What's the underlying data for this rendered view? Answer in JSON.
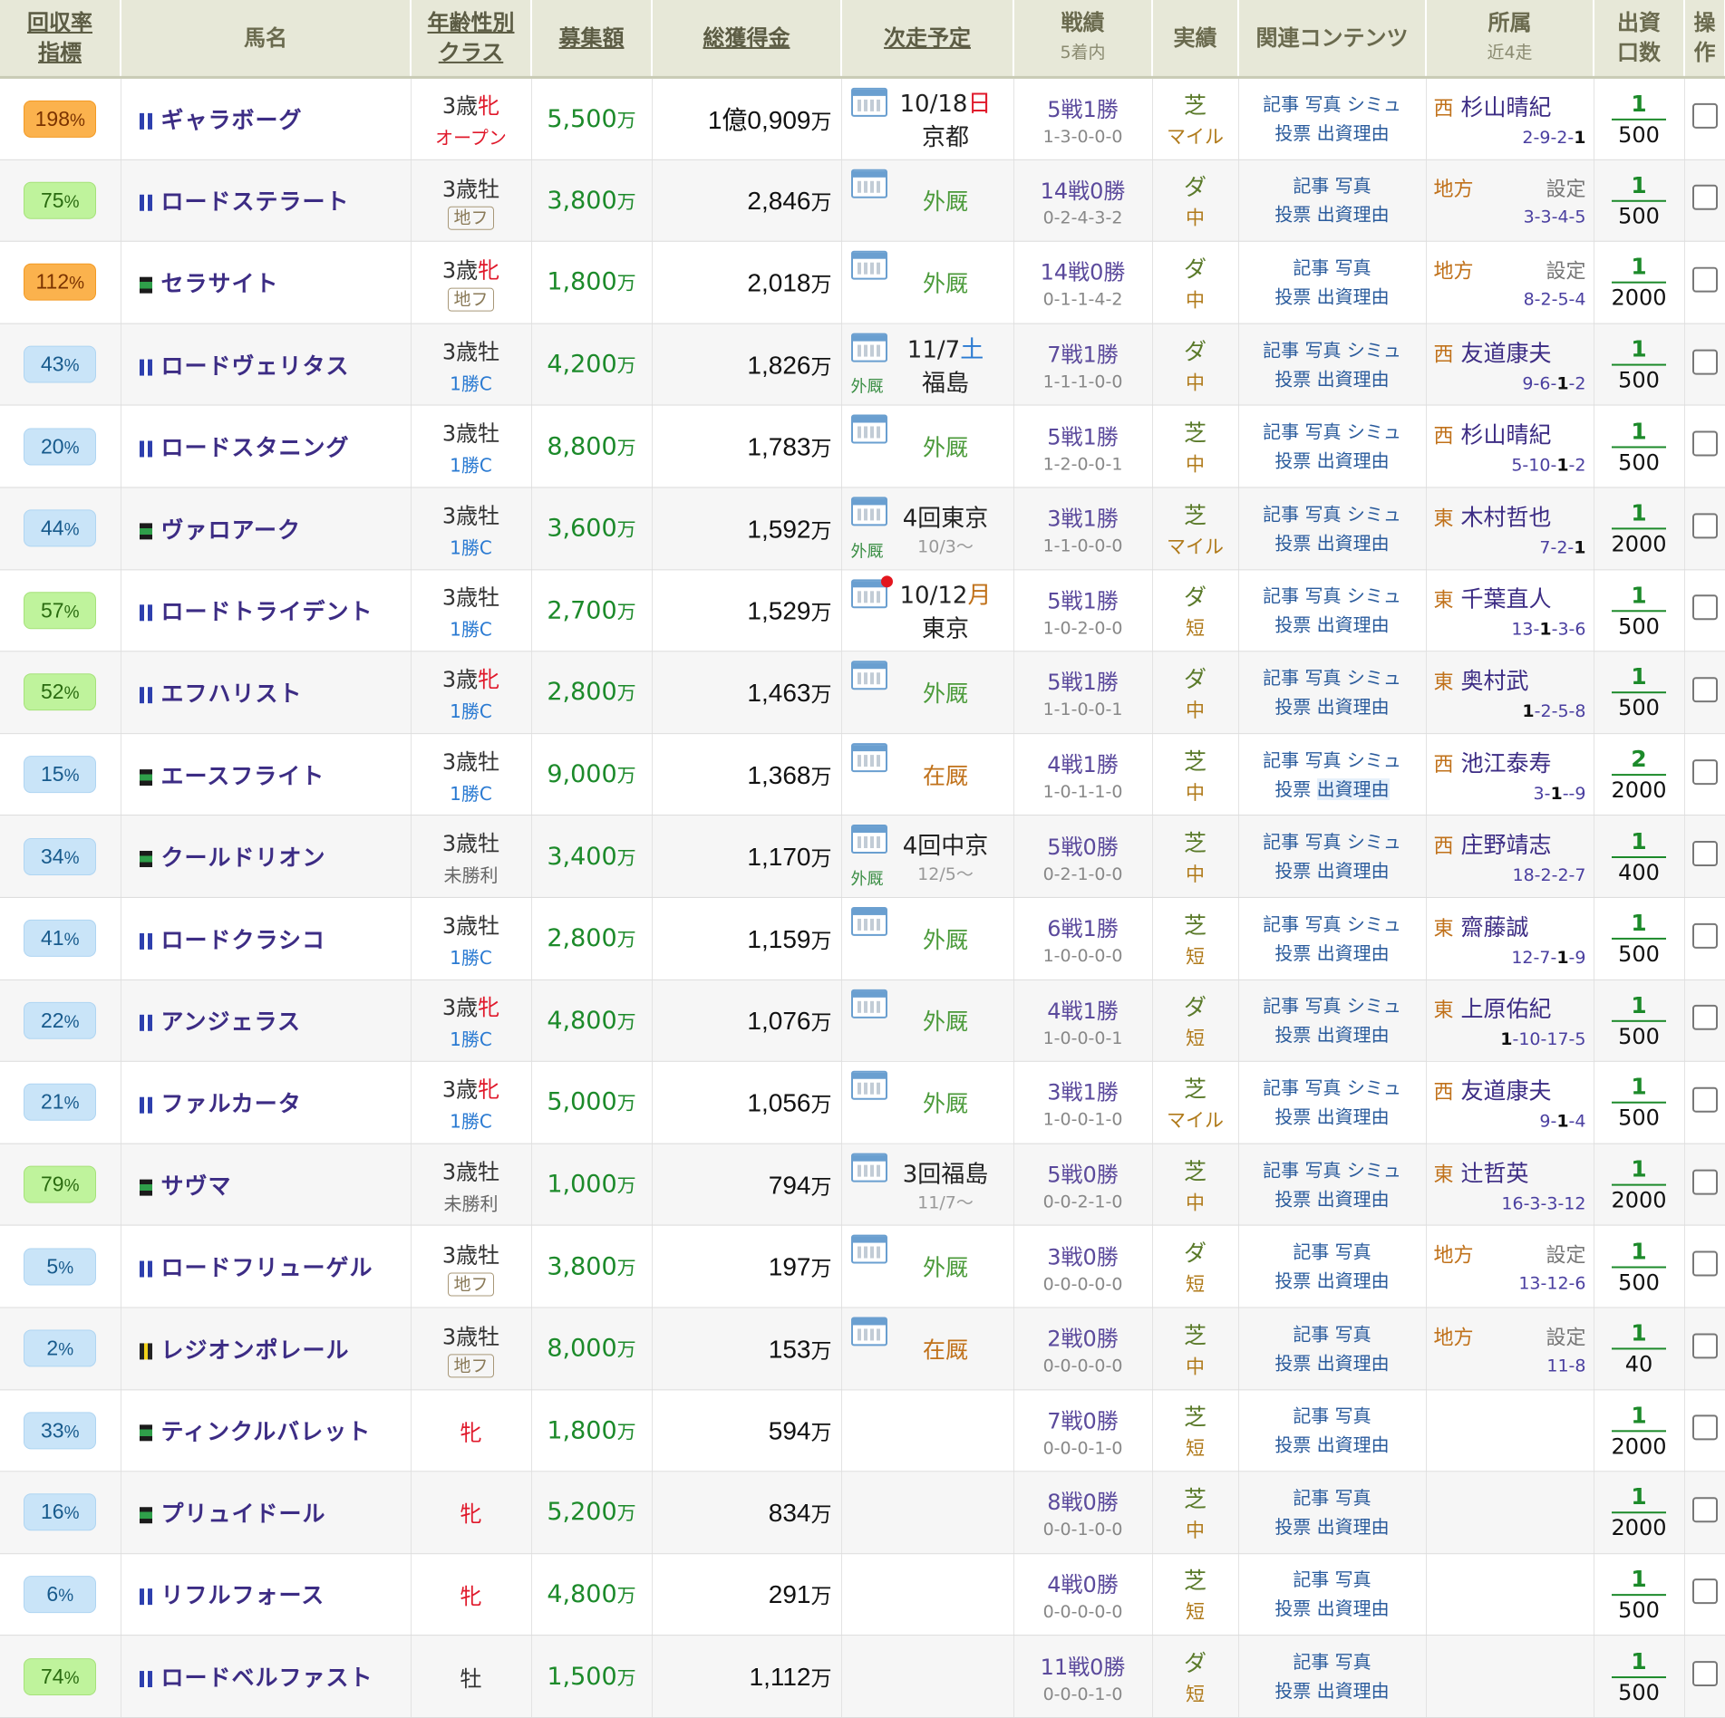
{
  "header": {
    "rate": [
      "回収率",
      "指標"
    ],
    "name": "馬名",
    "age": [
      "年齢性別",
      "クラス"
    ],
    "bosyu": "募集額",
    "prize": "総獲得金",
    "next": "次走予定",
    "record": [
      "戦績",
      "5着内"
    ],
    "perf": "実績",
    "links": "関連コンテンツ",
    "affil": [
      "所属",
      "近4走"
    ],
    "invest": [
      "出資",
      "口数"
    ],
    "op": [
      "操",
      "作"
    ]
  },
  "link_labels": {
    "kiji": "記事",
    "shashin": "写真",
    "shimu": "シミュ",
    "tohyo": "投票",
    "riyu": "出資理由"
  },
  "unit": "万",
  "rows": [
    {
      "rate": "198",
      "rc": "hi",
      "flag": "blue",
      "name": "ギャラボーグ",
      "age": "3歳",
      "sex": "牝",
      "cls": "オープン",
      "ct": "open",
      "bosyu": "5,500",
      "prize": "1億0,909",
      "next": {
        "date": "10/18",
        "dow": "日",
        "dowc": "sun",
        "place": "京都"
      },
      "rec": "5戦1勝",
      "rec2": "1-3-0-0-0",
      "surf": "芝",
      "dist": "マイル",
      "shimu": true,
      "region": "西",
      "trainer": "杉山晴紀",
      "settei": "",
      "recent": [
        "2-9-2-",
        "1"
      ],
      "k1": "1",
      "k2": "500"
    },
    {
      "rate": "75",
      "rc": "mid",
      "flag": "blue",
      "name": "ロードステラート",
      "age": "3歳",
      "sex": "牡",
      "cls": "地フ",
      "ct": "chiho",
      "bosyu": "3,800",
      "prize": "2,846",
      "next": {
        "stat": "外厩"
      },
      "rec": "14戦0勝",
      "rec2": "0-2-4-3-2",
      "surf": "ダ",
      "dist": "中",
      "shimu": false,
      "region": "地方",
      "trainer": "",
      "settei": "設定",
      "recent": [
        "3-3-4-5",
        ""
      ],
      "k1": "1",
      "k2": "500"
    },
    {
      "rate": "112",
      "rc": "hi",
      "flag": "black",
      "name": "セラサイト",
      "age": "3歳",
      "sex": "牝",
      "cls": "地フ",
      "ct": "chiho",
      "bosyu": "1,800",
      "prize": "2,018",
      "next": {
        "stat": "外厩"
      },
      "rec": "14戦0勝",
      "rec2": "0-1-1-4-2",
      "surf": "ダ",
      "dist": "中",
      "shimu": false,
      "region": "地方",
      "trainer": "",
      "settei": "設定",
      "recent": [
        "8-2-5-4",
        ""
      ],
      "k1": "1",
      "k2": "2000"
    },
    {
      "rate": "43",
      "rc": "lo",
      "flag": "blue",
      "name": "ロードヴェリタス",
      "age": "3歳",
      "sex": "牡",
      "cls": "1勝C",
      "ct": "c1",
      "bosyu": "4,200",
      "prize": "1,826",
      "next": {
        "date": "11/7",
        "dow": "土",
        "dowc": "sat",
        "place": "福島",
        "gk": "外厩"
      },
      "rec": "7戦1勝",
      "rec2": "1-1-1-0-0",
      "surf": "ダ",
      "dist": "中",
      "shimu": true,
      "region": "西",
      "trainer": "友道康夫",
      "settei": "",
      "recent": [
        "9-6-",
        "1",
        "-2"
      ],
      "k1": "1",
      "k2": "500"
    },
    {
      "rate": "20",
      "rc": "lo",
      "flag": "blue",
      "name": "ロードスタニング",
      "age": "3歳",
      "sex": "牡",
      "cls": "1勝C",
      "ct": "c1",
      "bosyu": "8,800",
      "prize": "1,783",
      "next": {
        "stat": "外厩"
      },
      "rec": "5戦1勝",
      "rec2": "1-2-0-0-1",
      "surf": "芝",
      "dist": "中",
      "shimu": true,
      "region": "西",
      "trainer": "杉山晴紀",
      "settei": "",
      "recent": [
        "5-10-",
        "1",
        "-2"
      ],
      "k1": "1",
      "k2": "500"
    },
    {
      "rate": "44",
      "rc": "lo",
      "flag": "black",
      "name": "ヴァロアーク",
      "age": "3歳",
      "sex": "牡",
      "cls": "1勝C",
      "ct": "c1",
      "bosyu": "3,600",
      "prize": "1,592",
      "next": {
        "main": "4回東京",
        "sub": "10/3～",
        "gk": "外厩"
      },
      "rec": "3戦1勝",
      "rec2": "1-1-0-0-0",
      "surf": "芝",
      "dist": "マイル",
      "shimu": true,
      "region": "東",
      "trainer": "木村哲也",
      "settei": "",
      "recent": [
        "7-2-",
        "1"
      ],
      "k1": "1",
      "k2": "2000"
    },
    {
      "rate": "57",
      "rc": "mid",
      "flag": "blue",
      "name": "ロードトライデント",
      "age": "3歳",
      "sex": "牡",
      "cls": "1勝C",
      "ct": "c1",
      "bosyu": "2,700",
      "prize": "1,529",
      "next": {
        "date": "10/12",
        "dow": "月",
        "dowc": "mon",
        "place": "東京",
        "dot": true
      },
      "rec": "5戦1勝",
      "rec2": "1-0-2-0-0",
      "surf": "ダ",
      "dist": "短",
      "shimu": true,
      "region": "東",
      "trainer": "千葉直人",
      "settei": "",
      "recent": [
        "13-",
        "1",
        "-3-6"
      ],
      "k1": "1",
      "k2": "500"
    },
    {
      "rate": "52",
      "rc": "mid",
      "flag": "blue",
      "name": "エフハリスト",
      "age": "3歳",
      "sex": "牝",
      "cls": "1勝C",
      "ct": "c1",
      "bosyu": "2,800",
      "prize": "1,463",
      "next": {
        "stat": "外厩"
      },
      "rec": "5戦1勝",
      "rec2": "1-1-0-0-1",
      "surf": "ダ",
      "dist": "中",
      "shimu": true,
      "region": "東",
      "trainer": "奥村武",
      "settei": "",
      "recent": [
        "",
        "1",
        "-2-5-8"
      ],
      "k1": "1",
      "k2": "500"
    },
    {
      "rate": "15",
      "rc": "lo",
      "flag": "black",
      "name": "エースフライト",
      "age": "3歳",
      "sex": "牡",
      "cls": "1勝C",
      "ct": "c1",
      "bosyu": "9,000",
      "prize": "1,368",
      "next": {
        "stat": "在厩",
        "in": true
      },
      "rec": "4戦1勝",
      "rec2": "1-0-1-1-0",
      "surf": "芝",
      "dist": "中",
      "shimu": true,
      "hl": true,
      "region": "西",
      "trainer": "池江泰寿",
      "settei": "",
      "recent": [
        "3-",
        "1",
        "--9"
      ],
      "k1": "2",
      "k2": "2000"
    },
    {
      "rate": "34",
      "rc": "lo",
      "flag": "black",
      "name": "クールドリオン",
      "age": "3歳",
      "sex": "牡",
      "cls": "未勝利",
      "ct": "plain",
      "bosyu": "3,400",
      "prize": "1,170",
      "next": {
        "main": "4回中京",
        "sub": "12/5～",
        "gk": "外厩"
      },
      "rec": "5戦0勝",
      "rec2": "0-2-1-0-0",
      "surf": "芝",
      "dist": "中",
      "shimu": true,
      "region": "西",
      "trainer": "庄野靖志",
      "settei": "",
      "recent": [
        "18-2-2-7",
        ""
      ],
      "k1": "1",
      "k2": "400"
    },
    {
      "rate": "41",
      "rc": "lo",
      "flag": "blue",
      "name": "ロードクラシコ",
      "age": "3歳",
      "sex": "牡",
      "cls": "1勝C",
      "ct": "c1",
      "bosyu": "2,800",
      "prize": "1,159",
      "next": {
        "stat": "外厩"
      },
      "rec": "6戦1勝",
      "rec2": "1-0-0-0-0",
      "surf": "芝",
      "dist": "短",
      "shimu": true,
      "region": "東",
      "trainer": "齋藤誠",
      "settei": "",
      "recent": [
        "12-7-",
        "1",
        "-9"
      ],
      "k1": "1",
      "k2": "500"
    },
    {
      "rate": "22",
      "rc": "lo",
      "flag": "blue",
      "name": "アンジェラス",
      "age": "3歳",
      "sex": "牝",
      "cls": "1勝C",
      "ct": "c1",
      "bosyu": "4,800",
      "prize": "1,076",
      "next": {
        "stat": "外厩"
      },
      "rec": "4戦1勝",
      "rec2": "1-0-0-0-1",
      "surf": "ダ",
      "dist": "短",
      "shimu": true,
      "region": "東",
      "trainer": "上原佑紀",
      "settei": "",
      "recent": [
        "",
        "1",
        "-10-17-5"
      ],
      "k1": "1",
      "k2": "500"
    },
    {
      "rate": "21",
      "rc": "lo",
      "flag": "blue",
      "name": "ファルカータ",
      "age": "3歳",
      "sex": "牝",
      "cls": "1勝C",
      "ct": "c1",
      "bosyu": "5,000",
      "prize": "1,056",
      "next": {
        "stat": "外厩"
      },
      "rec": "3戦1勝",
      "rec2": "1-0-0-1-0",
      "surf": "芝",
      "dist": "マイル",
      "shimu": true,
      "region": "西",
      "trainer": "友道康夫",
      "settei": "",
      "recent": [
        "9-",
        "1",
        "-4"
      ],
      "k1": "1",
      "k2": "500"
    },
    {
      "rate": "79",
      "rc": "mid",
      "flag": "black",
      "name": "サヴマ",
      "age": "3歳",
      "sex": "牡",
      "cls": "未勝利",
      "ct": "plain",
      "bosyu": "1,000",
      "prize": "794",
      "next": {
        "main": "3回福島",
        "sub": "11/7～"
      },
      "rec": "5戦0勝",
      "rec2": "0-0-2-1-0",
      "surf": "芝",
      "dist": "中",
      "shimu": true,
      "region": "東",
      "trainer": "辻哲英",
      "settei": "",
      "recent": [
        "16-3-3-12",
        ""
      ],
      "k1": "1",
      "k2": "2000"
    },
    {
      "rate": "5",
      "rc": "lo",
      "flag": "blue",
      "name": "ロードフリューゲル",
      "age": "3歳",
      "sex": "牡",
      "cls": "地フ",
      "ct": "chiho",
      "bosyu": "3,800",
      "prize": "197",
      "next": {
        "stat": "外厩"
      },
      "rec": "3戦0勝",
      "rec2": "0-0-0-0-0",
      "surf": "ダ",
      "dist": "短",
      "shimu": false,
      "region": "地方",
      "trainer": "",
      "settei": "設定",
      "recent": [
        "13-12-6",
        ""
      ],
      "k1": "1",
      "k2": "500"
    },
    {
      "rate": "2",
      "rc": "lo",
      "flag": "yellow",
      "name": "レジオンポレール",
      "age": "3歳",
      "sex": "牡",
      "cls": "地フ",
      "ct": "chiho",
      "bosyu": "8,000",
      "prize": "153",
      "next": {
        "stat": "在厩",
        "in": true
      },
      "rec": "2戦0勝",
      "rec2": "0-0-0-0-0",
      "surf": "芝",
      "dist": "中",
      "shimu": false,
      "region": "地方",
      "trainer": "",
      "settei": "設定",
      "recent": [
        "11-8",
        ""
      ],
      "k1": "1",
      "k2": "40"
    },
    {
      "rate": "33",
      "rc": "lo",
      "flag": "black",
      "name": "ティンクルバレット",
      "age": "",
      "sex": "牝",
      "cls": "",
      "ct": "none",
      "bosyu": "1,800",
      "prize": "594",
      "next": {},
      "rec": "7戦0勝",
      "rec2": "0-0-0-1-0",
      "surf": "芝",
      "dist": "短",
      "shimu": false,
      "region": "",
      "trainer": "",
      "settei": "",
      "recent": [
        "",
        ""
      ],
      "k1": "1",
      "k2": "2000"
    },
    {
      "rate": "16",
      "rc": "lo",
      "flag": "black",
      "name": "プリュイドール",
      "age": "",
      "sex": "牝",
      "cls": "",
      "ct": "none",
      "bosyu": "5,200",
      "prize": "834",
      "next": {},
      "rec": "8戦0勝",
      "rec2": "0-0-1-0-0",
      "surf": "芝",
      "dist": "中",
      "shimu": false,
      "region": "",
      "trainer": "",
      "settei": "",
      "recent": [
        "",
        ""
      ],
      "k1": "1",
      "k2": "2000"
    },
    {
      "rate": "6",
      "rc": "lo",
      "flag": "blue",
      "name": "リフルフォース",
      "age": "",
      "sex": "牝",
      "cls": "",
      "ct": "none",
      "bosyu": "4,800",
      "prize": "291",
      "next": {},
      "rec": "4戦0勝",
      "rec2": "0-0-0-0-0",
      "surf": "芝",
      "dist": "短",
      "shimu": false,
      "region": "",
      "trainer": "",
      "settei": "",
      "recent": [
        "",
        ""
      ],
      "k1": "1",
      "k2": "500"
    },
    {
      "rate": "74",
      "rc": "mid",
      "flag": "blue",
      "name": "ロードベルファスト",
      "age": "",
      "sex": "牡",
      "cls": "",
      "ct": "none",
      "bosyu": "1,500",
      "prize": "1,112",
      "next": {},
      "rec": "11戦0勝",
      "rec2": "0-0-0-1-0",
      "surf": "ダ",
      "dist": "短",
      "shimu": false,
      "region": "",
      "trainer": "",
      "settei": "",
      "recent": [
        "",
        ""
      ],
      "k1": "1",
      "k2": "500"
    }
  ]
}
